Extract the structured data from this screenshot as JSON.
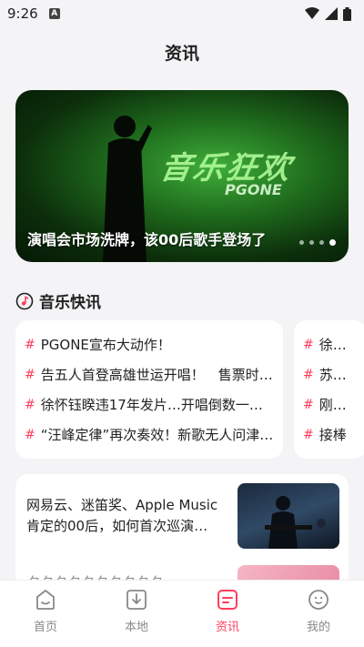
{
  "status_bar": {
    "time": "9:26",
    "notification_badge": "A"
  },
  "page": {
    "title": "资讯"
  },
  "banner": {
    "caption": "演唱会市场洗牌，该00后歌手登场了",
    "artwork_title": "音乐狂欢",
    "artwork_subtitle": "PGONE",
    "dot_count": 4,
    "active_dot": 3
  },
  "section": {
    "title": "音乐快讯"
  },
  "news_col1": [
    {
      "text": "PGONE宣布大动作！"
    },
    {
      "text": "告五人首登高雄世运开唱！　售票时…"
    },
    {
      "text": "徐怀钰睽违17年发片…开唱倒数一周…"
    },
    {
      "text": "“汪峰定律”再次奏效！新歌无人问津…"
    }
  ],
  "news_col2": [
    {
      "text": "徐佳莹"
    },
    {
      "text": "苏打绿"
    },
    {
      "text": "刚刚！"
    },
    {
      "text": "接棒"
    }
  ],
  "article": {
    "title": "网易云、迷笛奖、Apple Music肯定的00后，如何首次巡演…",
    "next_title": "夕夕夕夕夕夕夕夕夕夕"
  },
  "tabs": [
    {
      "label": "首页",
      "icon": "home-icon"
    },
    {
      "label": "本地",
      "icon": "download-icon"
    },
    {
      "label": "资讯",
      "icon": "news-icon"
    },
    {
      "label": "我的",
      "icon": "profile-icon"
    }
  ],
  "colors": {
    "accent": "#ff3e5b",
    "background": "#f4f4f7"
  }
}
